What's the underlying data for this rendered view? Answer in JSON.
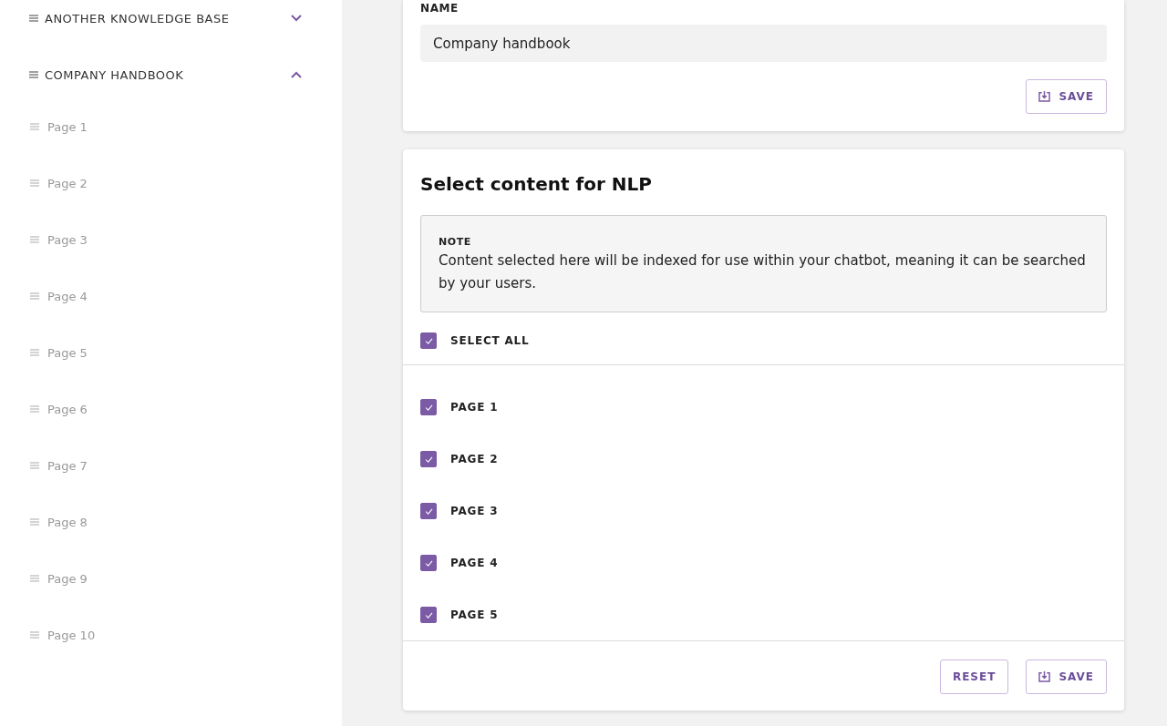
{
  "sidebar": {
    "knowledge_bases": [
      {
        "title": "ANOTHER KNOWLEDGE BASE",
        "expanded": false
      },
      {
        "title": "COMPANY HANDBOOK",
        "expanded": true,
        "children": [
          {
            "label": "Page 1"
          },
          {
            "label": "Page 2"
          },
          {
            "label": "Page 3"
          },
          {
            "label": "Page 4"
          },
          {
            "label": "Page 5"
          },
          {
            "label": "Page 6"
          },
          {
            "label": "Page 7"
          },
          {
            "label": "Page 8"
          },
          {
            "label": "Page 9"
          },
          {
            "label": "Page 10"
          }
        ]
      }
    ]
  },
  "name_card": {
    "label": "NAME",
    "value": "Company handbook",
    "save_button": "SAVE"
  },
  "nlp_card": {
    "title": "Select content for NLP",
    "note": {
      "heading": "NOTE",
      "text": "Content selected here will be indexed for use within your chatbot, meaning it can be searched by your users."
    },
    "select_all": {
      "label": "SELECT ALL",
      "checked": true
    },
    "pages": [
      {
        "label": "PAGE 1",
        "checked": true
      },
      {
        "label": "PAGE 2",
        "checked": true
      },
      {
        "label": "PAGE 3",
        "checked": true
      },
      {
        "label": "PAGE 4",
        "checked": true
      },
      {
        "label": "PAGE 5",
        "checked": true
      }
    ],
    "reset_button": "RESET",
    "save_button": "SAVE"
  }
}
